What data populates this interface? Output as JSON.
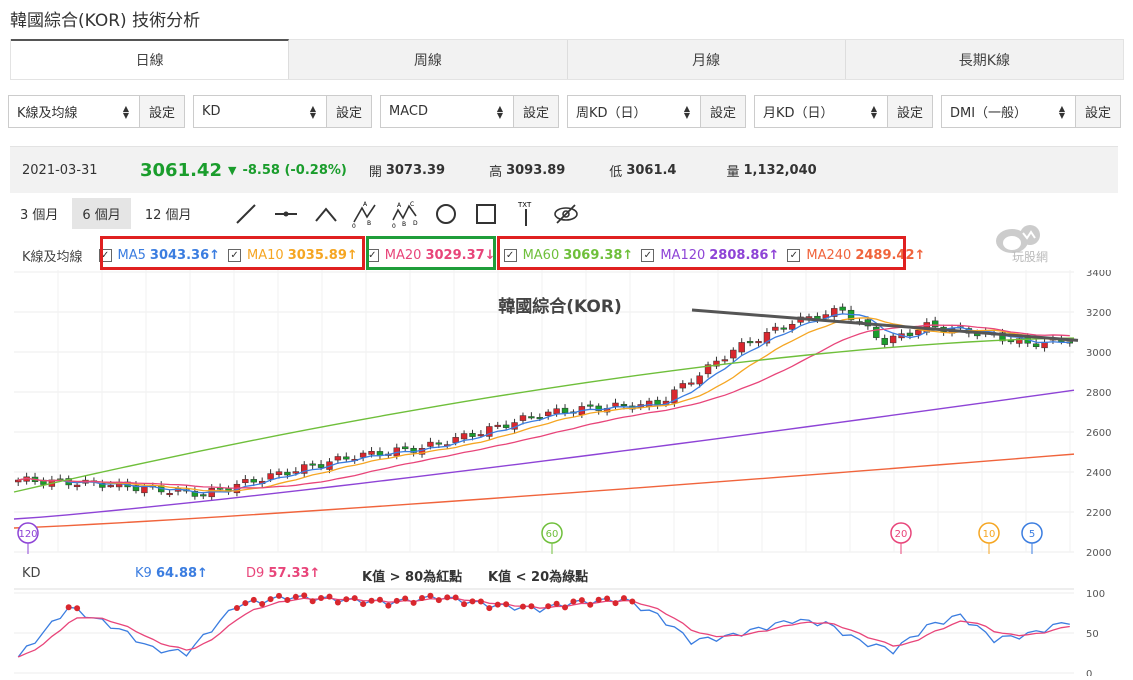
{
  "page_title": "韓國綜合(KOR) 技術分析",
  "tabs": [
    "日線",
    "周線",
    "月線",
    "長期K線"
  ],
  "selectors": [
    {
      "value": "K線及均線",
      "set": "設定"
    },
    {
      "value": "KD",
      "set": "設定"
    },
    {
      "value": "MACD",
      "set": "設定"
    },
    {
      "value": "周KD（日）",
      "set": "設定"
    },
    {
      "value": "月KD（日）",
      "set": "設定"
    },
    {
      "value": "DMI（一般）",
      "set": "設定"
    }
  ],
  "quote": {
    "date": "2021-03-31",
    "price": "3061.42",
    "change": "-8.58 (-0.28%)",
    "open_label": "開",
    "open": "3073.39",
    "high_label": "高",
    "high": "3093.89",
    "low_label": "低",
    "low": "3061.4",
    "volume_label": "量",
    "volume": "1,132,040"
  },
  "ranges": [
    "3 個月",
    "6 個月",
    "12 個月"
  ],
  "ma_legend": {
    "label": "K線及均線",
    "items": [
      {
        "name": "MA5",
        "value": "3043.36↑",
        "color": "#3b7de0"
      },
      {
        "name": "MA10",
        "value": "3035.89↑",
        "color": "#f5a623"
      },
      {
        "name": "MA20",
        "value": "3029.37↓",
        "color": "#e8457a"
      },
      {
        "name": "MA60",
        "value": "3069.38↑",
        "color": "#6fbf3b"
      },
      {
        "name": "MA120",
        "value": "2808.86↑",
        "color": "#8e44d6"
      },
      {
        "name": "MA240",
        "value": "2489.42↑",
        "color": "#f0643c"
      }
    ]
  },
  "logo_text": "玩股網",
  "chart_data": [
    {
      "type": "candlestick",
      "title": "韓國綜合(KOR)",
      "ylim": [
        2000,
        3400
      ],
      "yticks": [
        "3400",
        "3200",
        "3000",
        "2800",
        "2600",
        "2400",
        "2200",
        "2000"
      ],
      "series": [
        {
          "name": "MA5",
          "end": 3043.36
        },
        {
          "name": "MA10",
          "end": 3035.89
        },
        {
          "name": "MA20",
          "end": 3029.37
        },
        {
          "name": "MA60",
          "end": 3069.38
        },
        {
          "name": "MA120",
          "end": 2808.86
        },
        {
          "name": "MA240",
          "end": 2489.42
        }
      ],
      "markers": [
        "120",
        "60",
        "20",
        "10",
        "5"
      ]
    },
    {
      "type": "line",
      "title": "KD",
      "ylim": [
        0,
        100
      ],
      "yticks": [
        "100",
        "50",
        "0"
      ],
      "series": [
        {
          "name": "K9",
          "value": "64.88↑",
          "color": "#3b7de0"
        },
        {
          "name": "D9",
          "value": "57.33↑",
          "color": "#e8457a"
        }
      ],
      "notes": [
        "K值 > 80為紅點",
        "K值 < 20為綠點"
      ]
    }
  ],
  "colors": {
    "up": "#d9272e",
    "down": "#1a9d2c",
    "box_red": "#e02020",
    "box_green": "#1f9d3a"
  }
}
